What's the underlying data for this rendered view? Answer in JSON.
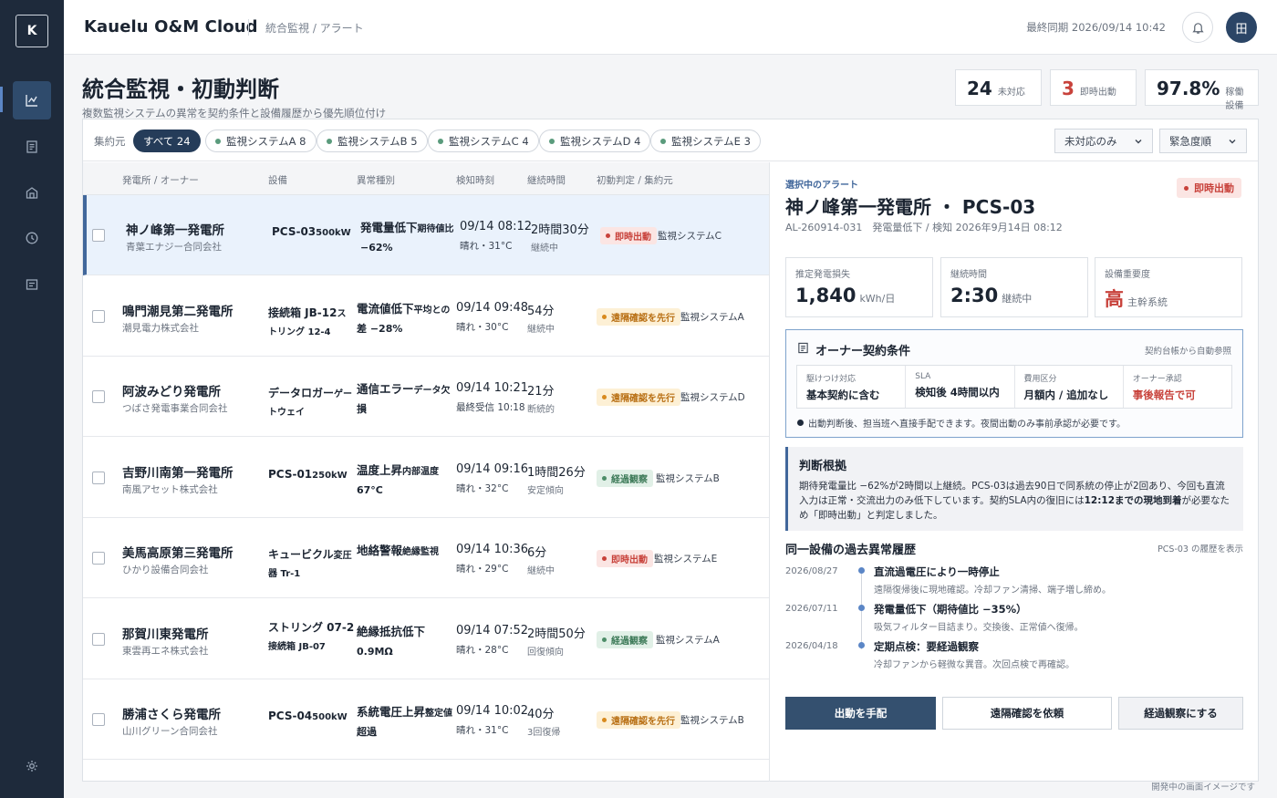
{
  "app": {
    "logo_letter": "K",
    "title": "Kauelu O&M Cloud",
    "breadcrumb": "統合監視 / アラート",
    "last_sync": "最終同期 2026/09/14 10:42",
    "user_initial": "田"
  },
  "sidebar": {
    "items": [
      {
        "icon": "chart-icon",
        "active": true
      },
      {
        "icon": "document-icon",
        "active": false
      },
      {
        "icon": "building-icon",
        "active": false
      },
      {
        "icon": "clock-icon",
        "active": false
      },
      {
        "icon": "list-icon",
        "active": false
      }
    ],
    "bottom_icon": "settings-icon"
  },
  "page": {
    "title": "統合監視・初動判断",
    "subtitle": "複数監視システムの異常を契約条件と設備履歴から優先順位付け"
  },
  "kpis": [
    {
      "value": "24",
      "label": "未対応",
      "color": "#1b2431"
    },
    {
      "value": "3",
      "label": "即時出動",
      "color": "#c8423b"
    },
    {
      "value": "97.8%",
      "label": "稼働設備",
      "color": "#1b2431"
    }
  ],
  "filters": {
    "label": "集約元",
    "chips": [
      "すべて 24",
      "監視システムA 8",
      "監視システムB 5",
      "監視システムC 4",
      "監視システムD 4",
      "監視システムE 3"
    ],
    "status_select": "未対応のみ",
    "sort_select": "緊急度順"
  },
  "table": {
    "headers": [
      "発電所 / オーナー",
      "設備",
      "異常種別",
      "検知時刻",
      "継続時間",
      "初動判定 / 集約元"
    ],
    "rows": [
      {
        "plant": "神ノ峰第一発電所",
        "owner": "青葉エナジー合同会社",
        "equip_main": "PCS-03",
        "equip_small": "500kW",
        "equip_sub": "",
        "type_main": "発電量低下",
        "type_small": "期待値比",
        "type_sub": "−62%",
        "detected": "09/14 08:12",
        "detected_sub": "晴れ・31°C",
        "duration": "2時間30分",
        "duration_sub": "継続中",
        "judgement": "即時出動",
        "severity": "red",
        "source": "監視システムC"
      },
      {
        "plant": "鳴門潮見第二発電所",
        "owner": "潮見電力株式会社",
        "equip_main": "接続箱 JB-12",
        "equip_small": "ストリング 12-4",
        "equip_sub": "",
        "type_main": "電流値低下",
        "type_small": "平均との",
        "type_sub": "差 −28%",
        "detected": "09/14 09:48",
        "detected_sub": "晴れ・30°C",
        "duration": "54分",
        "duration_sub": "継続中",
        "judgement": "遠隔確認を先行",
        "severity": "amber",
        "source": "監視システムA"
      },
      {
        "plant": "阿波みどり発電所",
        "owner": "つばさ発電事業合同会社",
        "equip_main": "データロガー",
        "equip_small": "ゲートウェイ",
        "equip_sub": "",
        "type_main": "通信エラー",
        "type_small": "データ欠",
        "type_sub": "損",
        "detected": "09/14 10:21",
        "detected_sub": "最終受信 10:18",
        "duration": "21分",
        "duration_sub": "断続的",
        "judgement": "遠隔確認を先行",
        "severity": "amber",
        "source": "監視システムD"
      },
      {
        "plant": "吉野川南第一発電所",
        "owner": "南風アセット株式会社",
        "equip_main": "PCS-01",
        "equip_small": "250kW",
        "equip_sub": "",
        "type_main": "温度上昇",
        "type_small": "内部温度",
        "type_sub": "67°C",
        "detected": "09/14 09:16",
        "detected_sub": "晴れ・32°C",
        "duration": "1時間26分",
        "duration_sub": "安定傾向",
        "judgement": "経過観察",
        "severity": "green",
        "source": "監視システムB"
      },
      {
        "plant": "美馬高原第三発電所",
        "owner": "ひかり設備合同会社",
        "equip_main": "キュービクル",
        "equip_small": "変圧器 Tr-1",
        "equip_sub": "",
        "type_main": "地絡警報",
        "type_small": "絶縁監視",
        "type_sub": "",
        "detected": "09/14 10:36",
        "detected_sub": "晴れ・29°C",
        "duration": "6分",
        "duration_sub": "継続中",
        "judgement": "即時出動",
        "severity": "red",
        "source": "監視システムE"
      },
      {
        "plant": "那賀川東発電所",
        "owner": "東雲再エネ株式会社",
        "equip_main": "ストリング 07-2",
        "equip_small": "",
        "equip_sub": "接続箱 JB-07",
        "type_main": "絶縁抵抗低下",
        "type_small": "",
        "type_sub": "0.9MΩ",
        "detected": "09/14 07:52",
        "detected_sub": "晴れ・28°C",
        "duration": "2時間50分",
        "duration_sub": "回復傾向",
        "judgement": "経過観察",
        "severity": "green",
        "source": "監視システムA"
      },
      {
        "plant": "勝浦さくら発電所",
        "owner": "山川グリーン合同会社",
        "equip_main": "PCS-04",
        "equip_small": "500kW",
        "equip_sub": "",
        "type_main": "系統電圧上昇",
        "type_small": "整定値",
        "type_sub": "超過",
        "detected": "09/14 10:02",
        "detected_sub": "晴れ・31°C",
        "duration": "40分",
        "duration_sub": "3回復帰",
        "judgement": "遠隔確認を先行",
        "severity": "amber",
        "source": "監視システムB"
      }
    ]
  },
  "detail": {
    "label": "選択中のアラート",
    "title": "神ノ峰第一発電所 ・ PCS-03",
    "meta": "AL-260914-031　発電量低下 / 検知 2026年9月14日 08:12",
    "badge": "即時出動",
    "metrics": [
      {
        "label": "推定発電損失",
        "value": "1,840",
        "unit": "kWh/日",
        "color": "#1b2431"
      },
      {
        "label": "継続時間",
        "value": "2:30",
        "unit": "継続中",
        "color": "#1b2431"
      },
      {
        "label": "設備重要度",
        "value": "高",
        "unit": "主幹系統",
        "color": "#c8423b"
      }
    ],
    "contract": {
      "title": "オーナー契約条件",
      "auto": "契約台帳から自動参照",
      "cells": [
        {
          "label": "駆けつけ対応",
          "value": "基本契約に含む"
        },
        {
          "label": "SLA",
          "value": "検知後 4時間以内"
        },
        {
          "label": "費用区分",
          "value": "月額内 / 追加なし"
        },
        {
          "label": "オーナー承認",
          "value": "事後報告で可"
        }
      ],
      "note": "出動判断後、担当班へ直接手配できます。夜間出動のみ事前承認が必要です。"
    },
    "basis": {
      "title": "判断根拠",
      "text_1": "期待発電量比 −62%が2時間以上継続。PCS-03は過去90日で同系統の停止が2回あり、今回も直流入力は正常・交流出力のみ低下しています。契約SLA内の復旧には",
      "text_bold": "12:12までの現地到着",
      "text_2": "が必要なため「即時出動」と判定しました。"
    },
    "history": {
      "title": "同一設備の過去異常履歴",
      "link": "PCS-03 の履歴を表示",
      "items": [
        {
          "date": "2026/08/27",
          "title": "直流過電圧により一時停止",
          "desc": "遠隔復帰後に現地確認。冷却ファン清掃、端子増し締め。"
        },
        {
          "date": "2026/07/11",
          "title": "発電量低下（期待値比 −35%）",
          "desc": "吸気フィルター目詰まり。交換後、正常値へ復帰。"
        },
        {
          "date": "2026/04/18",
          "title": "定期点検：要経過観察",
          "desc": "冷却ファンから軽微な異音。次回点検で再確認。"
        }
      ]
    },
    "actions": [
      "出動を手配",
      "遠隔確認を依頼",
      "経過観察にする"
    ]
  },
  "footnote": "開発中の画面イメージです"
}
